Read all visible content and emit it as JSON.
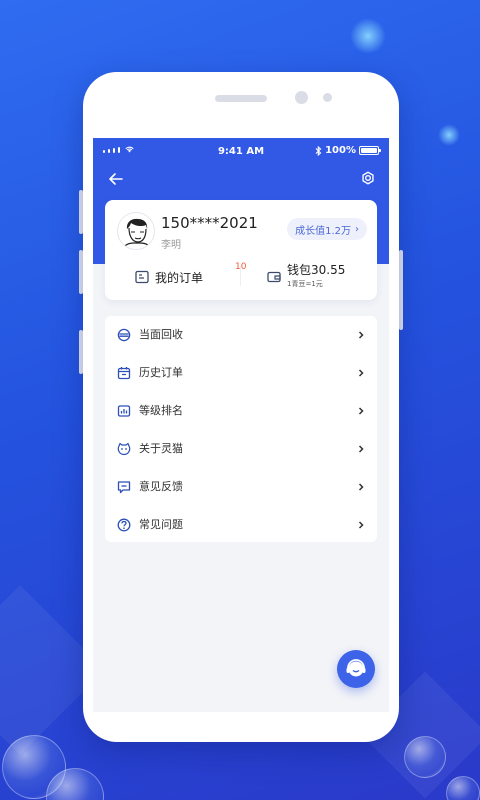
{
  "status_bar": {
    "time": "9:41 AM",
    "battery": "100%",
    "battery_level": 1.0
  },
  "nav": {
    "back_icon": "arrow-left-icon",
    "settings_icon": "gear-icon"
  },
  "profile": {
    "phone": "150****2021",
    "name": "李明",
    "growth_label": "成长值1.2万",
    "growth_chevron": "›"
  },
  "shortcuts": {
    "orders_label": "我的订单",
    "orders_badge": "10",
    "wallet_label": "钱包30.55",
    "wallet_sub": "1青豆=1元"
  },
  "menu": [
    {
      "label": "当面回收",
      "icon": "recycle-icon"
    },
    {
      "label": "历史订单",
      "icon": "calendar-icon"
    },
    {
      "label": "等级排名",
      "icon": "ranking-icon"
    },
    {
      "label": "关于灵猫",
      "icon": "cat-icon"
    },
    {
      "label": "意见反馈",
      "icon": "feedback-icon"
    },
    {
      "label": "常见问题",
      "icon": "help-icon"
    }
  ],
  "colors": {
    "primary": "#3159e6",
    "accent_blue": "#4a68d8",
    "badge_red": "#f05a3c",
    "background": "#2453df"
  }
}
